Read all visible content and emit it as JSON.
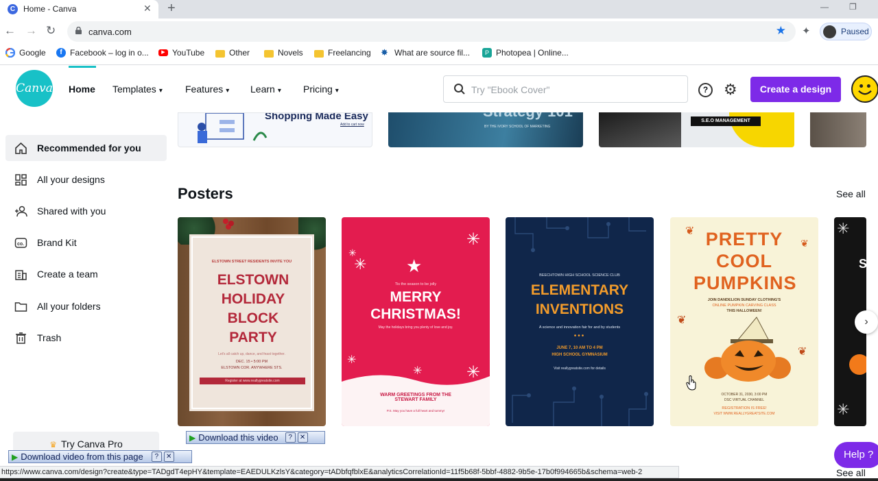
{
  "browser": {
    "tab_title": "Home - Canva",
    "tab_favicon": "C",
    "url": "canva.com",
    "profile_label": "Paused",
    "bookmarks": [
      {
        "label": "Google",
        "icon": "google-icon"
      },
      {
        "label": "Facebook – log in o...",
        "icon": "facebook-icon"
      },
      {
        "label": "YouTube",
        "icon": "youtube-icon"
      },
      {
        "label": "Other",
        "icon": "folder-icon"
      },
      {
        "label": "Novels",
        "icon": "folder-icon"
      },
      {
        "label": "Freelancing",
        "icon": "folder-icon"
      },
      {
        "label": "What are source fil...",
        "icon": "sun-icon"
      },
      {
        "label": "Photopea | Online...",
        "icon": "photopea-icon"
      }
    ],
    "status_url": "https://www.canva.com/design?create&type=TADgdT4epHY&template=EAEDULKzlsY&category=tADbfqfblxE&analyticsCorrelationId=11f5b68f-5bbf-4882-9b5e-17b0f994665b&schema=web-2"
  },
  "header": {
    "logo_text": "Canva",
    "nav": [
      {
        "label": "Home",
        "has_chevron": false
      },
      {
        "label": "Templates",
        "has_chevron": true
      },
      {
        "label": "Features",
        "has_chevron": true
      },
      {
        "label": "Learn",
        "has_chevron": true
      },
      {
        "label": "Pricing",
        "has_chevron": true
      }
    ],
    "search_placeholder": "Try \"Ebook Cover\"",
    "help_glyph": "?",
    "create_label": "Create a design"
  },
  "sidebar": {
    "items": [
      {
        "label": "Recommended for you",
        "icon": "home-icon",
        "active": true
      },
      {
        "label": "All your designs",
        "icon": "grid-icon",
        "active": false
      },
      {
        "label": "Shared with you",
        "icon": "people-icon",
        "active": false
      },
      {
        "label": "Brand Kit",
        "icon": "brand-kit-icon",
        "active": false
      },
      {
        "label": "Create a team",
        "icon": "team-icon",
        "active": false
      },
      {
        "label": "All your folders",
        "icon": "folder-icon",
        "active": false
      },
      {
        "label": "Trash",
        "icon": "trash-icon",
        "active": false
      }
    ],
    "try_pro": "Try Canva Pro"
  },
  "top_cards": [
    {
      "text": "Shopping Made Easy",
      "subtext": "Add to cart now"
    },
    {
      "text": "Strategy 101",
      "subtext": "BY THE IVORY SCHOOL OF MARKETING"
    },
    {
      "text": "S.E.O MANAGEMENT",
      "subtext": ""
    }
  ],
  "posters_section": {
    "title": "Posters",
    "see_all": "See all",
    "posters": [
      {
        "top": "ELSTOWN STREET RESIDENTS INVITE YOU",
        "title": "ELSTOWN HOLIDAY BLOCK PARTY",
        "body": "Let's all catch up, dance, and feast together.",
        "date": "DEC. 15 • 5:00 PM",
        "place": "ELSTOWN COR. ANYWHERE STS.",
        "cta": "Register at www.reallygreatsite.com"
      },
      {
        "top": "Tis the season to be jolly",
        "title": "MERRY CHRISTMAS!",
        "body": "May the holidays bring you plenty of love and joy.",
        "footer": "WARM GREETINGS FROM THE STEWART FAMILY",
        "ps": "P.S. May you have a full heart and tummy!"
      },
      {
        "top": "BEECHTOWN HIGH SCHOOL SCIENCE CLUB",
        "title": "ELEMENTARY INVENTIONS",
        "body": "A science and innovation fair for and by students",
        "date": "JUNE 7, 10 AM TO 4 PM",
        "place": "HIGH SCHOOL GYMNASIUM",
        "cta": "Visit reallygreatsite.com for details"
      },
      {
        "title": "PRETTY COOL PUMPKINS",
        "body": "JOIN DANDELION SUNDAY CLOTHING'S",
        "body2": "ONLINE PUMPKIN CARVING CLASS",
        "body3": "THIS HALLOWEEN!",
        "date": "OCTOBER 31, 2030, 3:00 PM",
        "place": "DSC VIRTUAL CHANNEL",
        "cta": "REGISTRATION IS FREE!",
        "cta2": "VISIT WWW.REALLYGREATSITE.COM"
      }
    ]
  },
  "overlays": {
    "download_video": "Download this video",
    "download_page": "Download video from this page",
    "help_label": "Help ?",
    "see_all_bottom": "See all"
  },
  "colors": {
    "brand_teal": "#18c1c7",
    "brand_purple": "#7d2ae8",
    "christmas_red": "#e31c4f",
    "navy": "#10264a",
    "pumpkin_orange": "#e8791e"
  }
}
